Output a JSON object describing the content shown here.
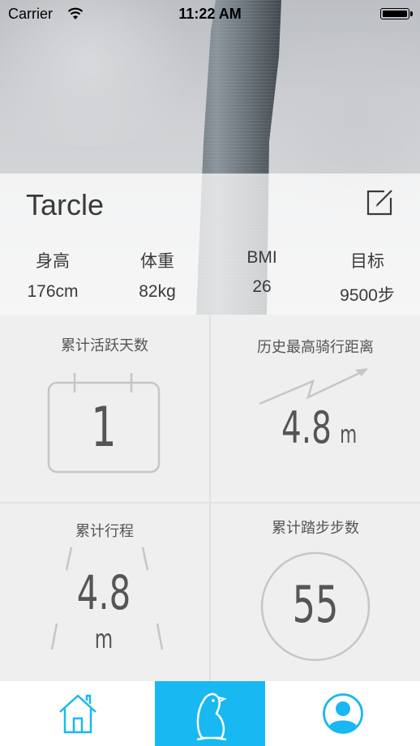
{
  "status_bar": {
    "carrier": "Carrier",
    "time": "11:22 AM"
  },
  "profile": {
    "name": "Tarcle",
    "stats": [
      {
        "label": "身高",
        "value": "176cm"
      },
      {
        "label": "体重",
        "value": "82kg"
      },
      {
        "label": "BMI",
        "value": "26"
      },
      {
        "label": "目标",
        "value": "9500步"
      }
    ]
  },
  "cards": {
    "active_days": {
      "title": "累计活跃天数",
      "value": "1"
    },
    "max_ride": {
      "title": "历史最高骑行距离",
      "value": "4.8",
      "unit": "m"
    },
    "total_trip": {
      "title": "累计行程",
      "value": "4.8",
      "unit": "m"
    },
    "total_steps": {
      "title": "累计踏步步数",
      "value": "55"
    }
  },
  "tabbar": {
    "items": [
      "home-icon",
      "penguin-icon",
      "user-icon"
    ],
    "active_index": 1,
    "accent": "#18b8f2"
  },
  "colors": {
    "text": "#3a3a3a",
    "card_bg": "#efefef",
    "icon_blue": "#18b8f2"
  }
}
